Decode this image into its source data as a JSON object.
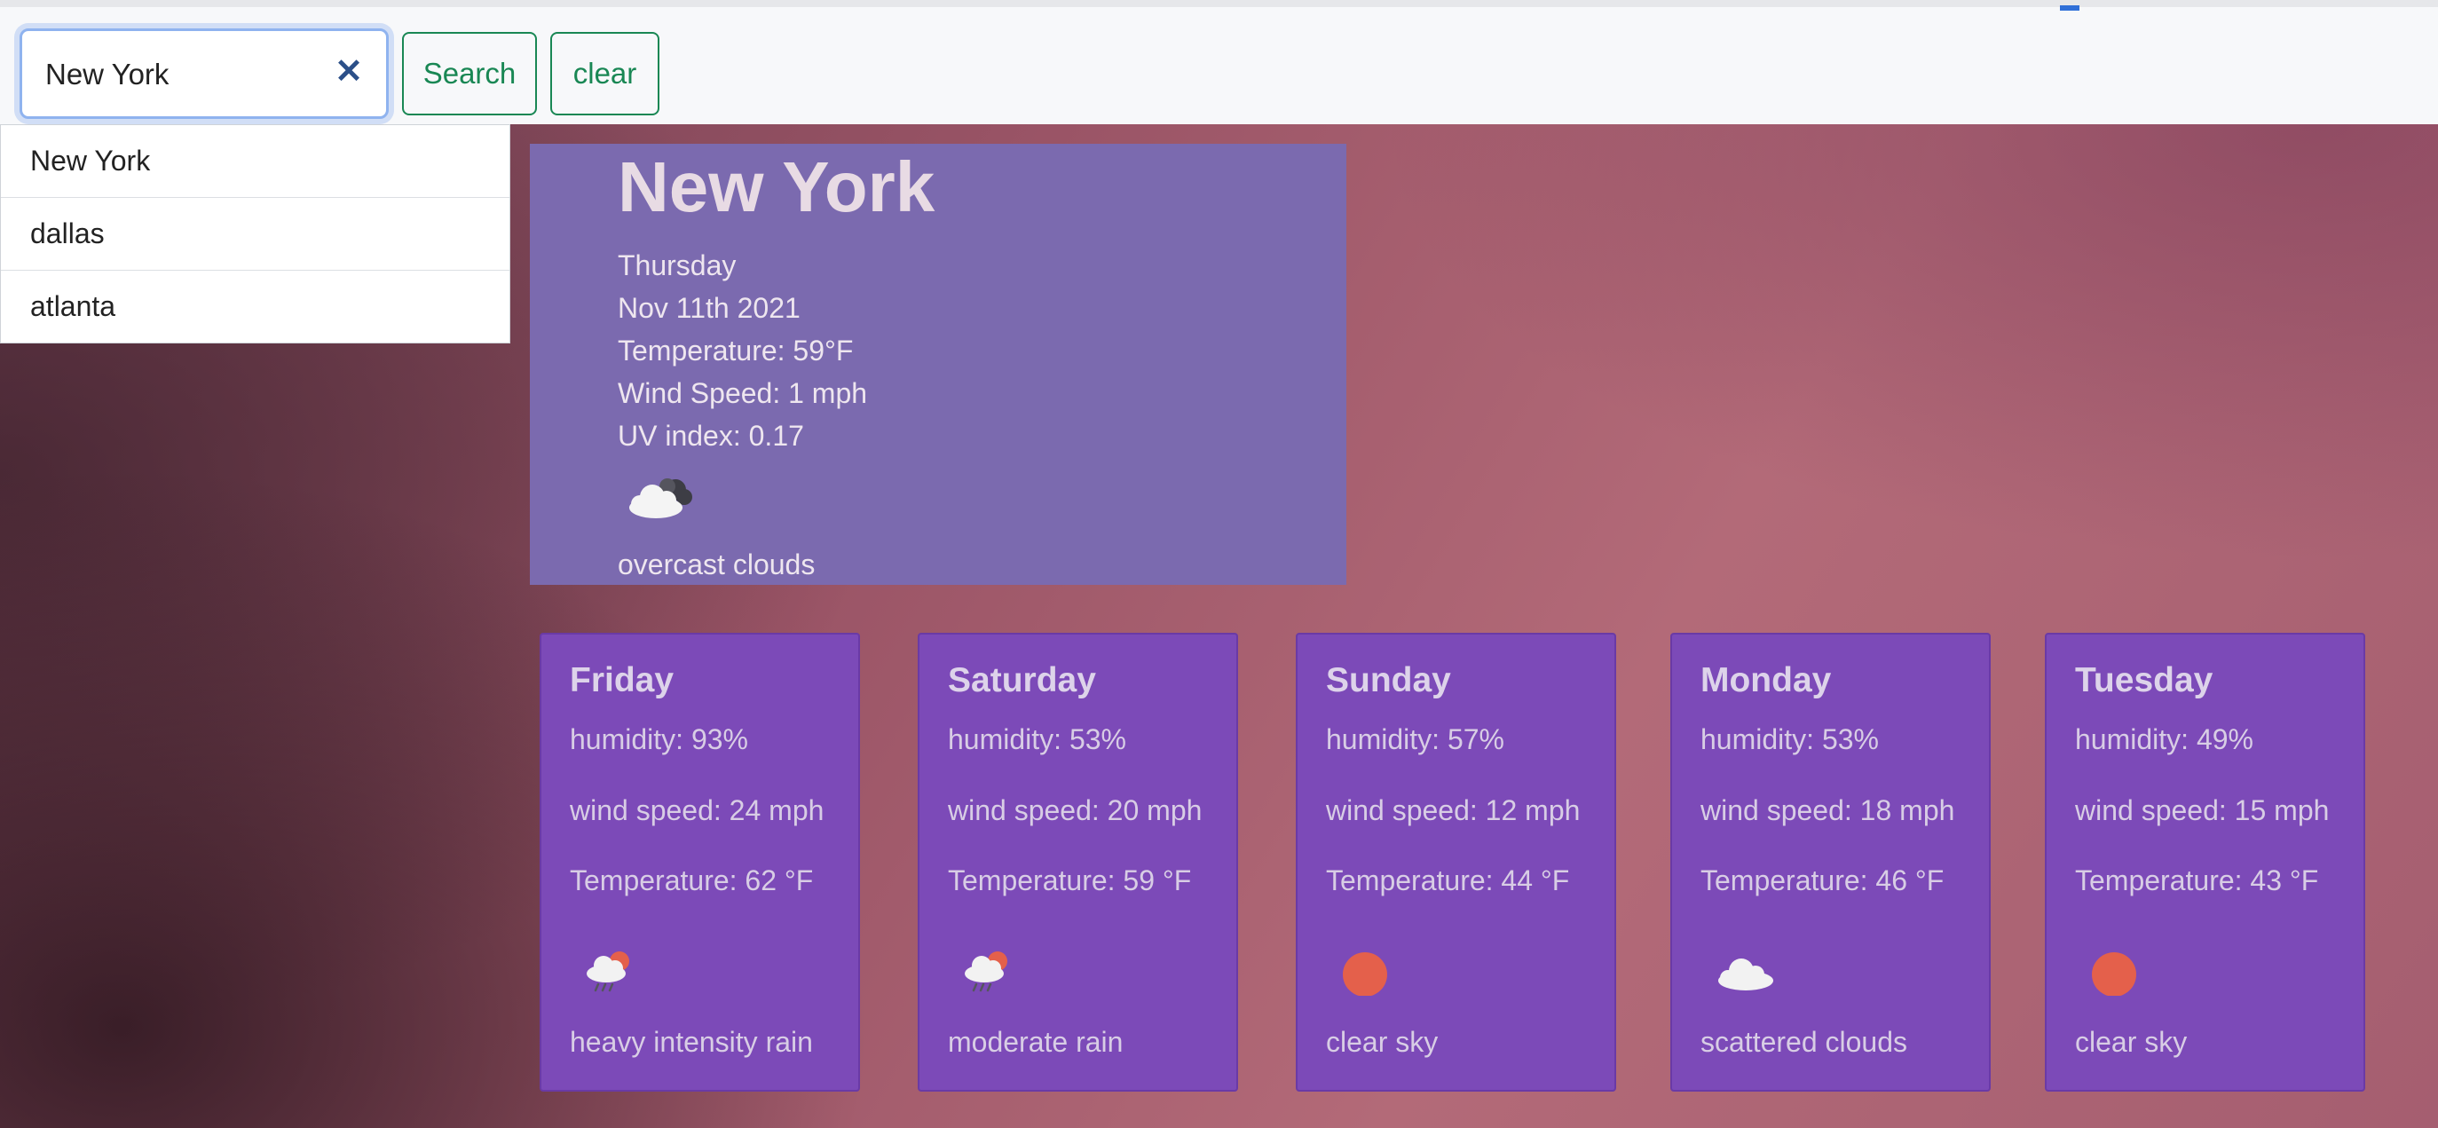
{
  "search": {
    "value": "New York",
    "clear_glyph": "✕",
    "search_label": "Search",
    "clear_label": "clear"
  },
  "history": [
    "New York",
    "dallas",
    "atlanta"
  ],
  "current": {
    "city": "New York",
    "day": "Thursday",
    "date": "Nov 11th 2021",
    "temperature": "Temperature: 59°F",
    "wind": "Wind Speed: 1 mph",
    "uv": "UV index: 0.17",
    "icon": "overcast-clouds-icon",
    "description": "overcast clouds"
  },
  "forecast": [
    {
      "day": "Friday",
      "humidity": "humidity: 93%",
      "wind": "wind speed: 24 mph",
      "temperature": "Temperature: 62 °F",
      "icon": "rain-cloud-sun-icon",
      "description": "heavy intensity rain"
    },
    {
      "day": "Saturday",
      "humidity": "humidity: 53%",
      "wind": "wind speed: 20 mph",
      "temperature": "Temperature: 59 °F",
      "icon": "rain-cloud-sun-icon",
      "description": "moderate rain"
    },
    {
      "day": "Sunday",
      "humidity": "humidity: 57%",
      "wind": "wind speed: 12 mph",
      "temperature": "Temperature: 44 °F",
      "icon": "sun-icon",
      "description": "clear sky"
    },
    {
      "day": "Monday",
      "humidity": "humidity: 53%",
      "wind": "wind speed: 18 mph",
      "temperature": "Temperature: 46 °F",
      "icon": "cloud-icon",
      "description": "scattered clouds"
    },
    {
      "day": "Tuesday",
      "humidity": "humidity: 49%",
      "wind": "wind speed: 15 mph",
      "temperature": "Temperature: 43 °F",
      "icon": "sun-icon",
      "description": "clear sky"
    }
  ],
  "colors": {
    "button_accent": "#198754",
    "current_panel": "#7b6aaf",
    "forecast_card": "#7c4ab8",
    "sun": "#e4604b"
  }
}
